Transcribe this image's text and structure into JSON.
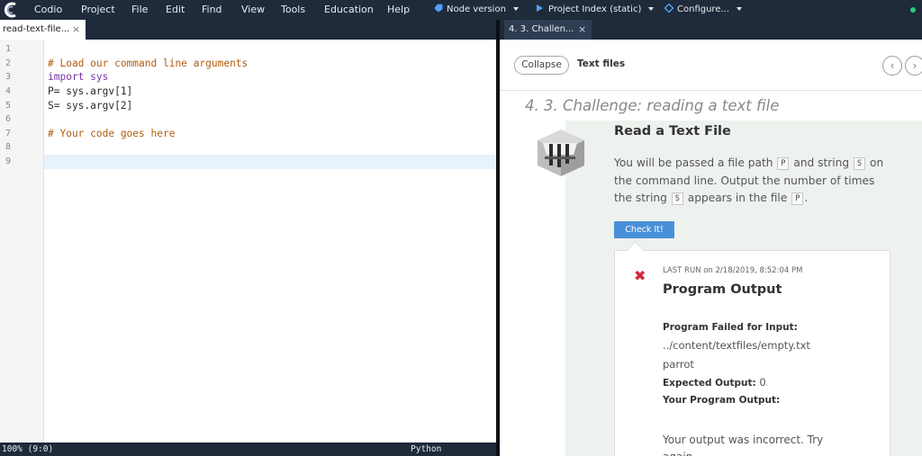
{
  "menubar": {
    "items": [
      "Codio",
      "Project",
      "File",
      "Edit",
      "Find",
      "View",
      "Tools",
      "Education",
      "Help"
    ],
    "node_version": "Node version",
    "project_index": "Project Index (static)",
    "configure": "Configure..."
  },
  "editor": {
    "tab_label": "read-text-file...",
    "close_glyph": "×",
    "line_numbers": [
      "1",
      "2",
      "3",
      "4",
      "5",
      "6",
      "7",
      "8",
      "9"
    ],
    "lines": [
      "",
      "# Load our command line arguments",
      "import sys",
      "P= sys.argv[1]",
      "S= sys.argv[2]",
      "",
      "# Your code goes here",
      "",
      ""
    ],
    "status_left": "100%  (9:0)",
    "status_right": "Python"
  },
  "guide": {
    "tab_label": "4. 3. Challen...",
    "close_glyph": "×",
    "collapse_label": "Collapse",
    "section_label": "Text files",
    "page_title": "4. 3. Challenge: reading a text file",
    "card_title": "Read a Text File",
    "para": {
      "t1": "You will be passed a file path ",
      "p": "P",
      "t2": " and string ",
      "s": "S",
      "t3": " on the command line. Output the number of times the string ",
      "t4": " appears in the file ",
      "t5": "."
    },
    "check_button": "Check It!",
    "result": {
      "last_run": "LAST RUN on 2/18/2019, 8:52:04 PM",
      "title": "Program Output",
      "failed_label": "Program Failed for Input:",
      "input_path": "../content/textfiles/empty.txt",
      "input_word": "parrot",
      "expected_label": "Expected Output:",
      "expected_value": "0",
      "your_label": "Your Program Output:",
      "message": "Your output was incorrect. Try again"
    }
  },
  "colors": {
    "topbar": "#1f2a3a",
    "accent_blue": "#4a90d9",
    "error_red": "#d4243b",
    "status_green": "#2ecc71"
  }
}
